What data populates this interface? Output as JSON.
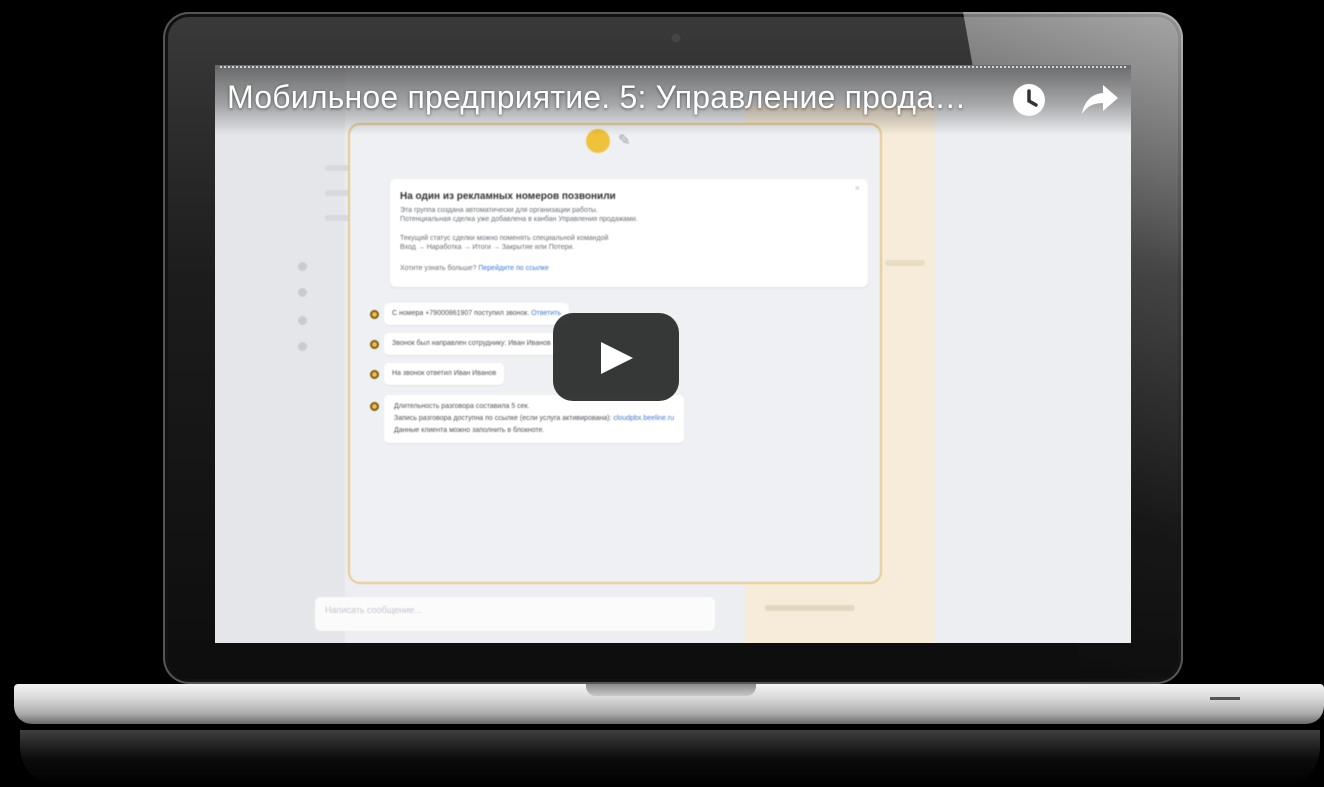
{
  "video": {
    "title": "Мобильное предприятие. 5: Управление прода…",
    "watch_later_icon": "clock-icon",
    "share_icon": "share-arrow-icon",
    "play_icon": "play-icon"
  },
  "app": {
    "timeline": {
      "avatar_initials": "",
      "date_label": "",
      "card": {
        "title": "На один из рекламных номеров позвонили",
        "lines": [
          "Эта группа создана автоматически для организации работы.",
          "Потенциальная сделка уже добавлена в канбан Управления продажами.",
          "",
          "Текущий статус сделки можно поменять специальной командой",
          "Вход → Наработка → Итоги → Закрытие или Потери.",
          ""
        ],
        "question": "Хотите узнать больше?",
        "link": "Перейдите по ссылке"
      },
      "events": [
        {
          "text": "С номера +79000861907 поступил звонок.",
          "link": "Ответить"
        },
        {
          "text": "Звонок был направлен сотруднику: Иван Иванов",
          "link": ""
        },
        {
          "text": "На звонок ответил Иван Иванов",
          "link": ""
        },
        {
          "text": "Длительность разговора составила 5 сек.",
          "text2": "Запись разговора доступна по ссылке (если услуга активирована):",
          "link": "cloudpbx.beeline.ru",
          "text3": "Данные клиента можно заполнить в блокноте."
        }
      ]
    },
    "input_placeholder": "Написать сообщение..."
  },
  "colors": {
    "accent_yellow": "#f0c23c",
    "panel_border": "#e6c98d",
    "link_blue": "#3d7ad1",
    "play_bg": "#1c1c1c"
  }
}
